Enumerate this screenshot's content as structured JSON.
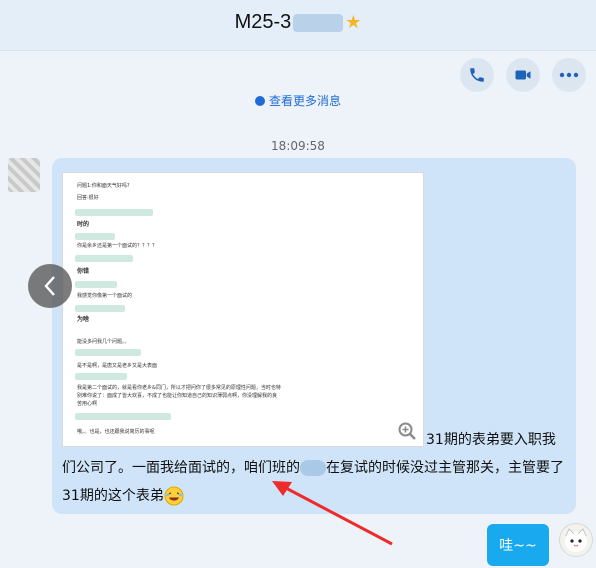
{
  "header": {
    "title": "M25-3",
    "actions": {
      "phone": "phone-icon",
      "video": "video-icon",
      "more": "more-icon"
    }
  },
  "feed": {
    "more_messages": "查看更多消息",
    "timestamp": "18:09:58"
  },
  "message": {
    "screenshot_lines": [
      "问题1:你和面天气好吗?",
      "回答:很好",
      "时的",
      "你是余乡还是第一个面试的？？？？",
      "你错",
      "我感觉你像第一个面试的",
      "为啥",
      "能没多问我几个问题。。",
      "是不是啊，是唐又是老乡又是大表面",
      "我是第二个面试的，就是看你老乡&同门，所以才把问你了很多常见的原理性问题，当时也特",
      "别难你说了：面成了皆大欢喜，不成了也能让你知道自己的知识薄弱点啊，你没理解我的良",
      "苦用心啊",
      "哦。。也是，也还跟我说简历的事呢"
    ],
    "text": "31期的表弟要入职我们公司了。一面我给面试的，咱们班的在复试的时候没过主管那关，主管要了31期的这个表弟"
  },
  "reply": {
    "text": "哇~~"
  },
  "colors": {
    "accent": "#1e6bd6",
    "reply_bubble": "#19a9ee",
    "bubble": "#cfe4f8"
  }
}
